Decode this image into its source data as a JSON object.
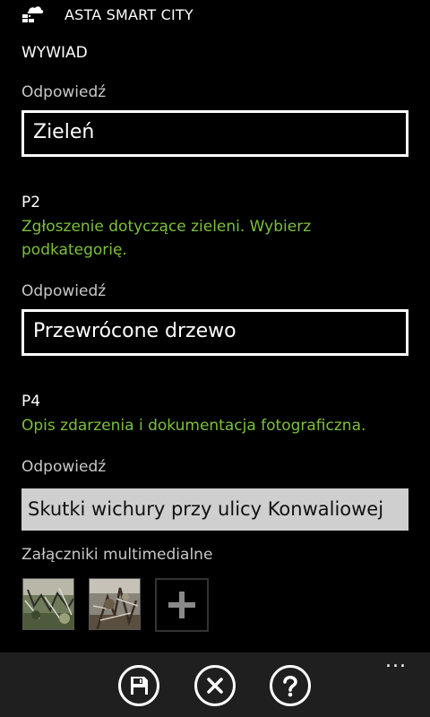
{
  "header": {
    "app_title": "ASTA SMART CITY",
    "app_icon": "cloud-grid-icon"
  },
  "survey": {
    "section_title": "WYWIAD",
    "q1": {
      "answer_label": "Odpowiedź",
      "answer_value": "Zieleń"
    },
    "q2": {
      "id": "P2",
      "text": "Zgłoszenie dotyczące zieleni. Wybierz podkategorię.",
      "answer_label": "Odpowiedź",
      "answer_value": "Przewrócone drzewo"
    },
    "q4": {
      "id": "P4",
      "text": "Opis zdarzenia i dokumentacja fotograficzna.",
      "answer_label": "Odpowiedź",
      "answer_value": "Skutki wichury przy ulicy Konwaliowej"
    },
    "attachments_label": "Załączniki multimedialne"
  },
  "app_bar": {
    "buttons": [
      "save-icon",
      "close-icon",
      "help-icon"
    ],
    "more": "..."
  },
  "colors": {
    "accent_green": "#7cc03a",
    "background": "#000000",
    "app_bar": "#1f1f1f"
  }
}
